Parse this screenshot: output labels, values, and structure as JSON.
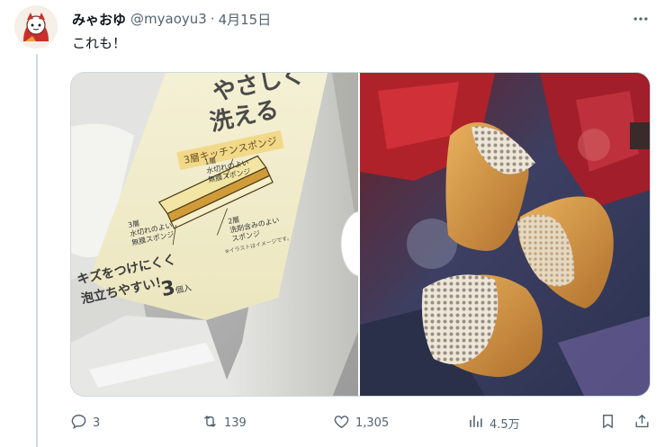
{
  "tweet": {
    "name": "みゃおゆ",
    "handle": "@myaoyu3",
    "separator": "·",
    "date": "4月15日",
    "text": "これも！"
  },
  "package": {
    "title_line1": "やさしく",
    "title_line2": "洗える",
    "subtitle": "3層キッチンスポンジ",
    "layer1_num": "1層",
    "layer1_text1": "水切れのよい",
    "layer1_text2": "無膜スポンジ",
    "layer2_num": "2層",
    "layer2_text1": "洗剤含みのよい",
    "layer2_text2": "スポンジ",
    "layer3_num": "3層",
    "layer3_text1": "水切れのよい",
    "layer3_text2": "無膜スポンジ",
    "note": "※イラストはイメージです。",
    "slogan1": "キズをつけにくく",
    "slogan2": "泡立ちやすい！",
    "count_num": "3",
    "count_unit": "個入"
  },
  "actions": {
    "replies": "3",
    "reposts": "139",
    "likes": "1,305",
    "views": "4.5万"
  },
  "colors": {
    "text_primary": "#0f1419",
    "text_secondary": "#536471",
    "border": "#cfd9de"
  },
  "icons": [
    "more-icon",
    "reply-icon",
    "repost-icon",
    "like-icon",
    "views-icon",
    "bookmark-icon",
    "share-icon"
  ]
}
